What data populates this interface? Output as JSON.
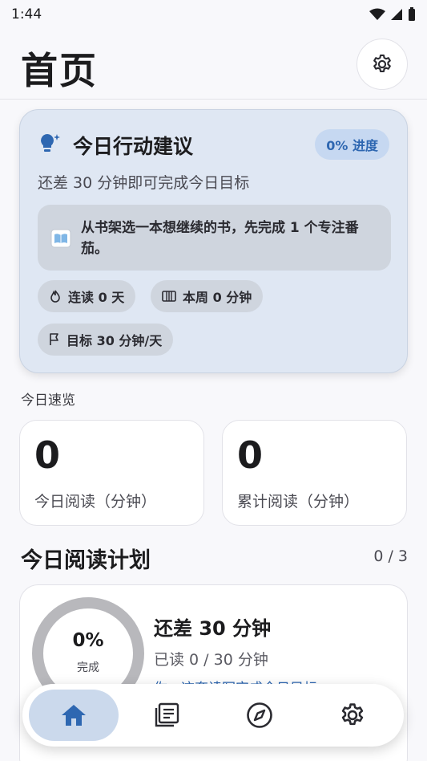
{
  "status_bar": {
    "time": "1:44"
  },
  "header": {
    "title": "首页"
  },
  "suggestion": {
    "title": "今日行动建议",
    "progress_chip": "0% 进度",
    "subtitle": "还差 30 分钟即可完成今日目标",
    "tip": "从书架选一本想继续的书，先完成 1 个专注番茄。",
    "chips": {
      "streak": "连读 0 天",
      "week": "本周 0 分钟",
      "goal": "目标 30 分钟/天"
    }
  },
  "overview": {
    "label": "今日速览",
    "today_value": "0",
    "today_label": "今日阅读（分钟）",
    "total_value": "0",
    "total_label": "累计阅读（分钟）"
  },
  "plan": {
    "title": "今日阅读计划",
    "count": "0 / 3",
    "ring_percent": "0%",
    "ring_label": "完成",
    "progress": 0,
    "headline": "还差 30 分钟",
    "read": "已读 0 / 30 分钟",
    "hint": "你，这套读写完成今日目标"
  },
  "nav": {
    "items": [
      "home-icon",
      "library-icon",
      "explore-icon",
      "settings-icon"
    ],
    "active": "home-icon"
  },
  "colors": {
    "accent": "#2e67b1",
    "card_bg": "#dfe7f3",
    "nav_active": "#cbd9ec"
  }
}
